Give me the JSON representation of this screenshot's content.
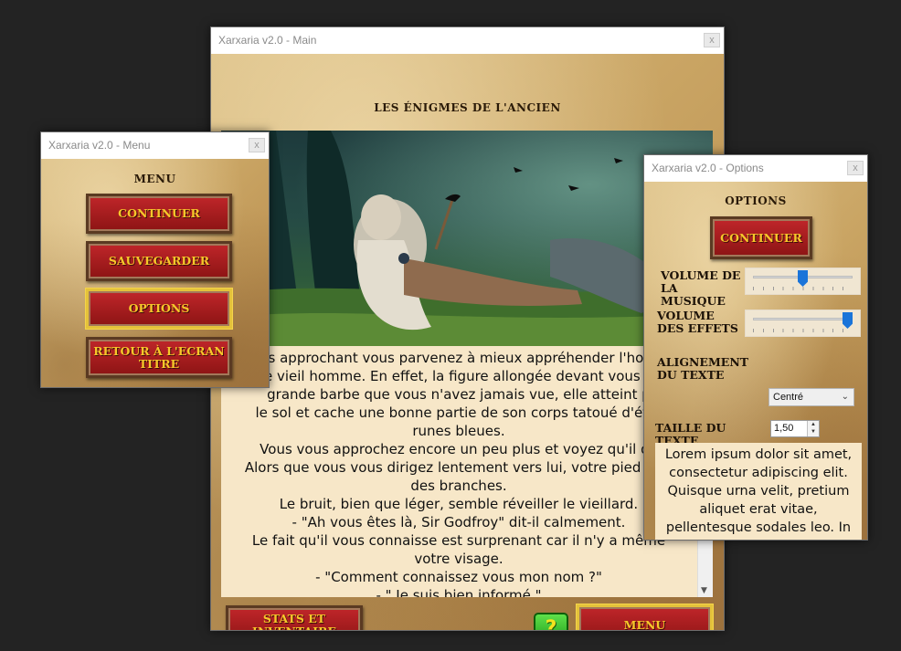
{
  "main_window": {
    "title": "Xarxaria v2.0 - Main",
    "close": "x",
    "heading": "LES ÉNIGMES DE L'ANCIEN",
    "story_lines": [
      "s approchant vous parvenez à mieux appréhender l'hor",
      "e vieil homme. En effet, la figure allongée devant vous p",
      "grande barbe que vous n'avez jamais vue, elle atteint p",
      "le sol et cache une bonne partie de son corps tatoué d'étra",
      "runes bleues.",
      "Vous vous approchez encore un peu plus et voyez qu'il de",
      "Alors que vous vous dirigez lentement vers lui, votre pied mar",
      "des branches.",
      "Le bruit, bien que léger, semble réveiller le vieillard.",
      "- \"Ah vous êtes là, Sir Godfroy\" dit-il calmement.",
      "Le fait qu'il vous connaisse est surprenant car il n'y a même",
      "votre visage.",
      "- \"Comment connaissez vous mon nom ?\"",
      "- \" Je suis bien informé \""
    ],
    "scroll_down": "▼",
    "stats_button": "STATS ET INVENTAIRE",
    "help_button": "?",
    "menu_button": "MENU"
  },
  "menu_window": {
    "title": "Xarxaria v2.0 - Menu",
    "close": "x",
    "heading": "MENU",
    "continue_button": "CONTINUER",
    "save_button": "SAUVEGARDER",
    "options_button": "OPTIONS",
    "back_button": "RETOUR À L'ECRAN TITRE"
  },
  "options_window": {
    "title": "Xarxaria v2.0 - Options",
    "close": "x",
    "heading": "OPTIONS",
    "continue_button": "CONTINUER",
    "music_label": "VOLUME DE LA MUSIQUE",
    "music_value": 0.5,
    "effects_label": "VOLUME DES EFFETS",
    "effects_value": 1.0,
    "align_label": "ALIGNEMENT DU TEXTE",
    "align_value": "Centré",
    "size_label": "TAILLE DU TEXTE",
    "size_value": "1,50",
    "preview_text": "Lorem ipsum dolor sit amet, consectetur adipiscing elit. Quisque urna velit, pretium aliquet erat vitae, pellentesque sodales leo. In volutpat."
  },
  "colors": {
    "button_red": "#a81c1f",
    "button_text": "#f7c72a",
    "selected_border": "#e4c23a",
    "help_green": "#3cc030",
    "slider_thumb": "#1a74d9"
  }
}
